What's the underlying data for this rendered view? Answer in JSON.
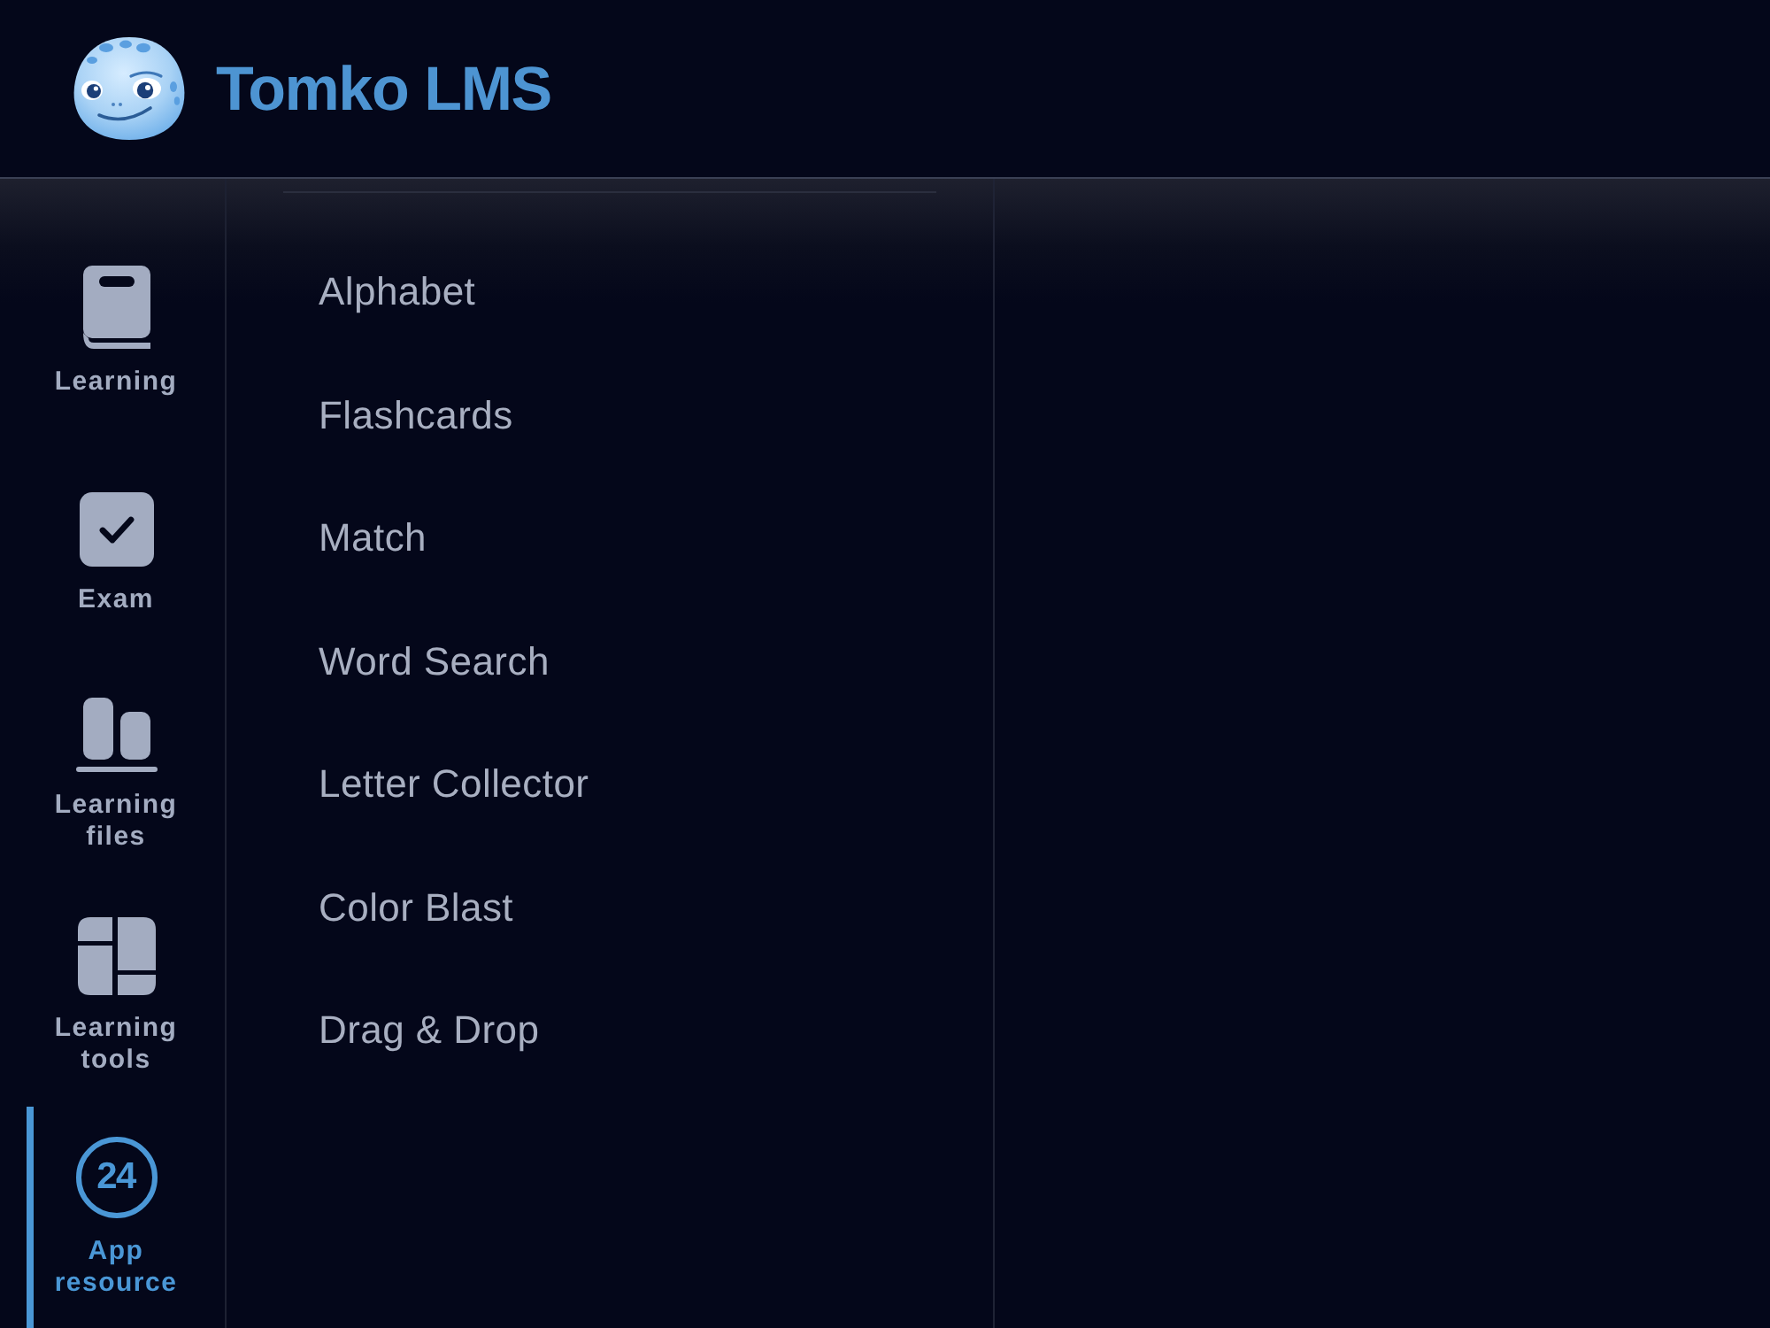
{
  "header": {
    "app_name": "Tomko LMS"
  },
  "sidebar": {
    "items": [
      {
        "kind": "book",
        "label": "Learning",
        "selected": false
      },
      {
        "kind": "check",
        "label": "Exam",
        "selected": false
      },
      {
        "kind": "files",
        "label": "Learning files",
        "selected": false
      },
      {
        "kind": "tools",
        "label": "Learning tools",
        "selected": false
      },
      {
        "kind": "badge",
        "badge": "24",
        "label": "App resource",
        "selected": true
      }
    ]
  },
  "menu": {
    "items": [
      "Alphabet",
      "Flashcards",
      "Match",
      "Word Search",
      "Letter Collector",
      "Color Blast",
      "Drag & Drop"
    ]
  }
}
